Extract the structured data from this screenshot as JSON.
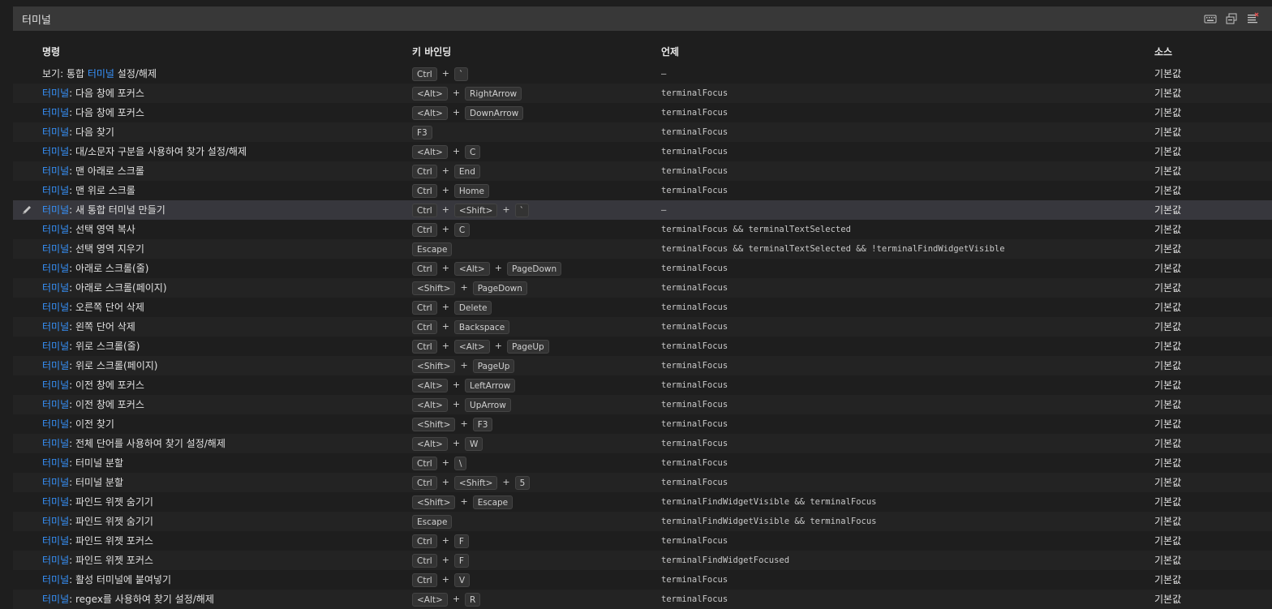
{
  "header": {
    "title": "터미널"
  },
  "columns": {
    "command": "명령",
    "keybinding": "키 바인딩",
    "when": "언제",
    "source": "소스"
  },
  "prefix_color": "#3794ff",
  "rows": [
    {
      "pre": "",
      "cmd_pre_text": "보기: 통합 ",
      "pre_mid": "터미널",
      "cmd_post": " 설정/해제",
      "keys": [
        "Ctrl",
        "`"
      ],
      "when": "—",
      "source": "기본값"
    },
    {
      "pre": "터미널",
      "cmd": ": 다음 창에 포커스",
      "keys": [
        "<Alt>",
        "RightArrow"
      ],
      "when": "terminalFocus",
      "source": "기본값"
    },
    {
      "pre": "터미널",
      "cmd": ": 다음 창에 포커스",
      "keys": [
        "<Alt>",
        "DownArrow"
      ],
      "when": "terminalFocus",
      "source": "기본값"
    },
    {
      "pre": "터미널",
      "cmd": ": 다음 찾기",
      "keys": [
        "F3"
      ],
      "when": "terminalFocus",
      "source": "기본값"
    },
    {
      "pre": "터미널",
      "cmd": ": 대/소문자 구분을 사용하여 찾가 설정/해제",
      "keys": [
        "<Alt>",
        "C"
      ],
      "when": "terminalFocus",
      "source": "기본값"
    },
    {
      "pre": "터미널",
      "cmd": ": 맨 아래로 스크롤",
      "keys": [
        "Ctrl",
        "End"
      ],
      "when": "terminalFocus",
      "source": "기본값"
    },
    {
      "pre": "터미널",
      "cmd": ": 맨 위로 스크롤",
      "keys": [
        "Ctrl",
        "Home"
      ],
      "when": "terminalFocus",
      "source": "기본값"
    },
    {
      "pre": "터미널",
      "cmd": ": 새 통합 터미널 만들기",
      "keys": [
        "Ctrl",
        "<Shift>",
        "`"
      ],
      "when": "—",
      "source": "기본값",
      "selected": true
    },
    {
      "pre": "터미널",
      "cmd": ": 선택 영역 복사",
      "keys": [
        "Ctrl",
        "C"
      ],
      "when": "terminalFocus && terminalTextSelected",
      "source": "기본값"
    },
    {
      "pre": "터미널",
      "cmd": ": 선택 영역 지우기",
      "keys": [
        "Escape"
      ],
      "when": "terminalFocus && terminalTextSelected && !terminalFindWidgetVisible",
      "source": "기본값"
    },
    {
      "pre": "터미널",
      "cmd": ": 아래로 스크롤(줄)",
      "keys": [
        "Ctrl",
        "<Alt>",
        "PageDown"
      ],
      "when": "terminalFocus",
      "source": "기본값"
    },
    {
      "pre": "터미널",
      "cmd": ": 아래로 스크롤(페이지)",
      "keys": [
        "<Shift>",
        "PageDown"
      ],
      "when": "terminalFocus",
      "source": "기본값"
    },
    {
      "pre": "터미널",
      "cmd": ": 오른쪽 단어 삭제",
      "keys": [
        "Ctrl",
        "Delete"
      ],
      "when": "terminalFocus",
      "source": "기본값"
    },
    {
      "pre": "터미널",
      "cmd": ": 왼쪽 단어 삭제",
      "keys": [
        "Ctrl",
        "Backspace"
      ],
      "when": "terminalFocus",
      "source": "기본값"
    },
    {
      "pre": "터미널",
      "cmd": ": 위로 스크롤(줄)",
      "keys": [
        "Ctrl",
        "<Alt>",
        "PageUp"
      ],
      "when": "terminalFocus",
      "source": "기본값"
    },
    {
      "pre": "터미널",
      "cmd": ": 위로 스크롤(페이지)",
      "keys": [
        "<Shift>",
        "PageUp"
      ],
      "when": "terminalFocus",
      "source": "기본값"
    },
    {
      "pre": "터미널",
      "cmd": ": 이전 창에 포커스",
      "keys": [
        "<Alt>",
        "LeftArrow"
      ],
      "when": "terminalFocus",
      "source": "기본값"
    },
    {
      "pre": "터미널",
      "cmd": ": 이전 창에 포커스",
      "keys": [
        "<Alt>",
        "UpArrow"
      ],
      "when": "terminalFocus",
      "source": "기본값"
    },
    {
      "pre": "터미널",
      "cmd": ": 이전 찾기",
      "keys": [
        "<Shift>",
        "F3"
      ],
      "when": "terminalFocus",
      "source": "기본값"
    },
    {
      "pre": "터미널",
      "cmd": ": 전체 단어를 사용하여 찾기 설정/해제",
      "keys": [
        "<Alt>",
        "W"
      ],
      "when": "terminalFocus",
      "source": "기본값"
    },
    {
      "pre": "터미널",
      "cmd": ": 터미널 분할",
      "keys": [
        "Ctrl",
        "\\"
      ],
      "when": "terminalFocus",
      "source": "기본값"
    },
    {
      "pre": "터미널",
      "cmd": ": 터미널 분할",
      "keys": [
        "Ctrl",
        "<Shift>",
        "5"
      ],
      "when": "terminalFocus",
      "source": "기본값"
    },
    {
      "pre": "터미널",
      "cmd": ": 파인드 위젯 숨기기",
      "keys": [
        "<Shift>",
        "Escape"
      ],
      "when": "terminalFindWidgetVisible && terminalFocus",
      "source": "기본값"
    },
    {
      "pre": "터미널",
      "cmd": ": 파인드 위젯 숨기기",
      "keys": [
        "Escape"
      ],
      "when": "terminalFindWidgetVisible && terminalFocus",
      "source": "기본값"
    },
    {
      "pre": "터미널",
      "cmd": ": 파인드 위젯 포커스",
      "keys": [
        "Ctrl",
        "F"
      ],
      "when": "terminalFocus",
      "source": "기본값"
    },
    {
      "pre": "터미널",
      "cmd": ": 파인드 위젯 포커스",
      "keys": [
        "Ctrl",
        "F"
      ],
      "when": "terminalFindWidgetFocused",
      "source": "기본값"
    },
    {
      "pre": "터미널",
      "cmd": ": 활성 터미널에 붙여넣기",
      "keys": [
        "Ctrl",
        "V"
      ],
      "when": "terminalFocus",
      "source": "기본값"
    },
    {
      "pre": "터미널",
      "cmd": ": regex를 사용하여 찾기 설정/해제",
      "keys": [
        "<Alt>",
        "R"
      ],
      "when": "terminalFocus",
      "source": "기본값"
    }
  ],
  "icons": {
    "header": [
      "keyboard-icon",
      "open-json-icon",
      "clear-list-icon"
    ],
    "row_edit": "pencil-icon"
  }
}
